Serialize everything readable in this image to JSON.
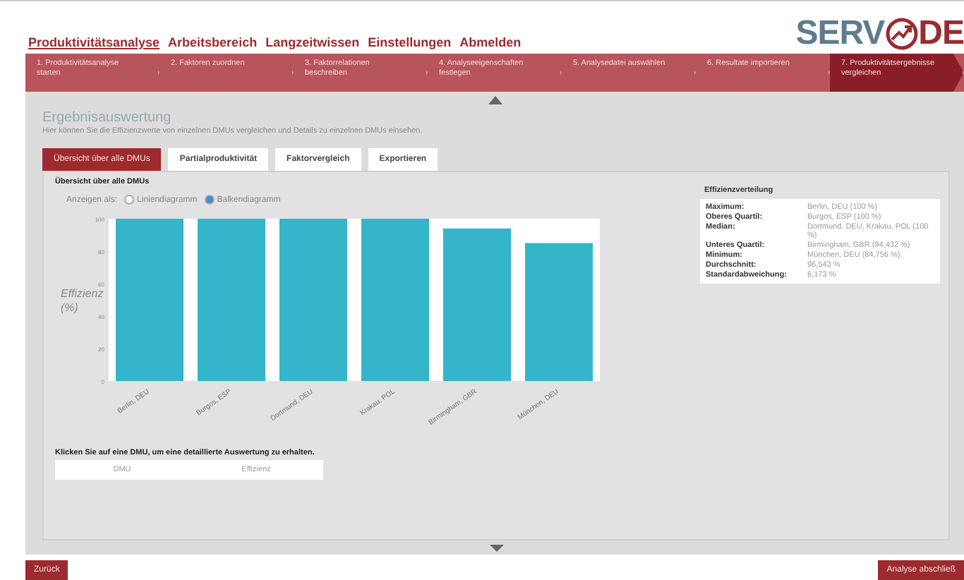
{
  "nav": [
    {
      "label": "Produktivitätsanalyse",
      "selected": true
    },
    {
      "label": "Arbeitsbereich",
      "selected": false
    },
    {
      "label": "Langzeitwissen",
      "selected": false
    },
    {
      "label": "Einstellungen",
      "selected": false
    },
    {
      "label": "Abmelden",
      "selected": false
    }
  ],
  "logo": {
    "left": "SERV",
    "right": "DE"
  },
  "steps": [
    {
      "label": "1. Produktivitätsanalyse starten",
      "selected": false
    },
    {
      "label": "2. Faktoren zuordnen",
      "selected": false
    },
    {
      "label": "3. Faktorrelationen beschreiben",
      "selected": false
    },
    {
      "label": "4. Analyseeigenschaften festlegen",
      "selected": false
    },
    {
      "label": "5. Analysedatei auswählen",
      "selected": false
    },
    {
      "label": "6. Resultate importieren",
      "selected": false
    },
    {
      "label": "7. Produktivitätsergebnisse vergleichen",
      "selected": true
    }
  ],
  "page": {
    "title": "Ergebnisauswertung",
    "description": "Hier können Sie die Effizienzwerte von einzelnen DMUs vergleichen und Details zu einzelnen DMUs einsehen."
  },
  "tabs": [
    {
      "label": "Übersicht über alle DMUs",
      "selected": true
    },
    {
      "label": "Partialproduktivität",
      "selected": false
    },
    {
      "label": "Faktorvergleich",
      "selected": false
    },
    {
      "label": "Exportieren",
      "selected": false
    }
  ],
  "section_title": "Übersicht über alle DMUs",
  "display": {
    "label": "Anzeigen als:",
    "options": [
      {
        "label": "Liniendiagramm",
        "selected": false
      },
      {
        "label": "Balkendiagramm",
        "selected": true
      }
    ]
  },
  "chart_data": {
    "type": "bar",
    "ylabel": "Effizienz (%)",
    "categories": [
      "Berlin, DEU",
      "Burgos, ESP",
      "Dortmund, DEU",
      "Krakau, POL",
      "Birmingham, GBR",
      "München, DEU"
    ],
    "series": [
      {
        "color": "#35b5c9",
        "values": [
          100,
          100,
          100,
          100,
          94,
          85
        ]
      }
    ],
    "ylim": [
      0,
      100
    ],
    "yticks": [
      0,
      20,
      40,
      60,
      80,
      100
    ]
  },
  "distribution": {
    "title": "Effizienzverteilung",
    "rows": [
      {
        "label": "Maximum:",
        "value": "Berlin, DEU (100 %)"
      },
      {
        "label": "Oberes Quartil:",
        "value": "Burgos, ESP (100 %)"
      },
      {
        "label": "Median:",
        "value": "Dortmund, DEU, Krakau, POL (100 %)"
      },
      {
        "label": "Unteres Quartil:",
        "value": "Birmingham, GBR (94,432 %)"
      },
      {
        "label": "Minimum:",
        "value": "München, DEU (84,756 %)"
      },
      {
        "label": "Durchschnitt:",
        "value": "96,543 %"
      },
      {
        "label": "Standardabweichung:",
        "value": "6,173 %"
      }
    ]
  },
  "hint": "Klicken Sie auf eine DMU, um eine detaillierte Auswertung zu erhalten.",
  "table": {
    "columns": [
      "DMU",
      "Effizienz"
    ]
  },
  "buttons": {
    "back": "Zurück",
    "finish": "Analyse abschließ"
  }
}
